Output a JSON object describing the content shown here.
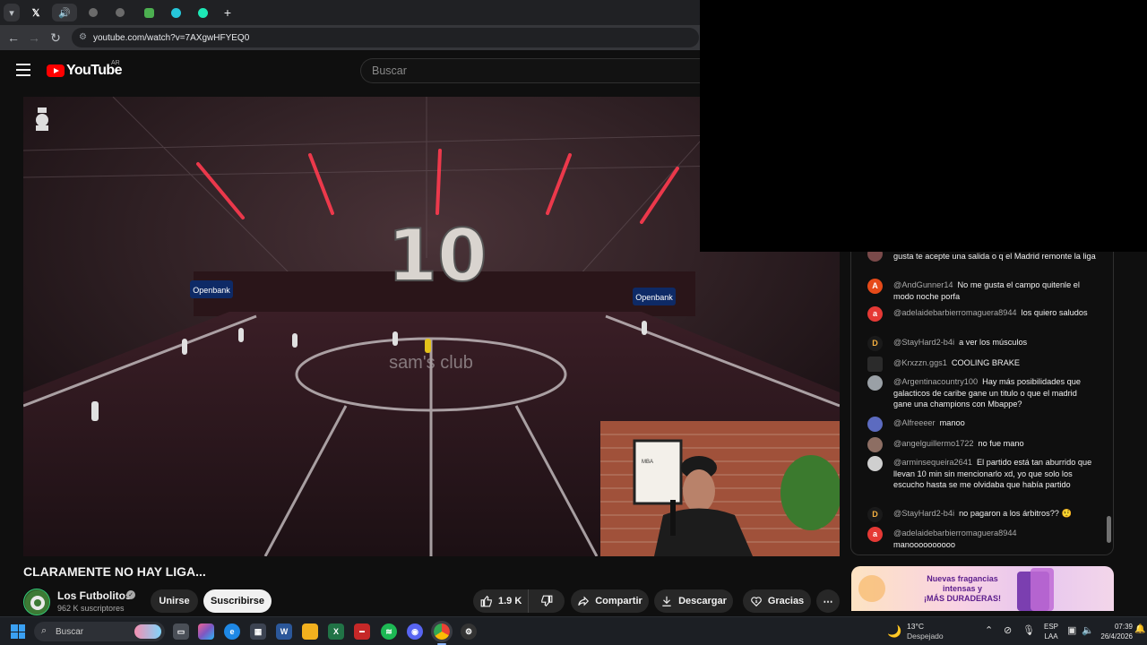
{
  "browser": {
    "url": "youtube.com/watch?v=7AXgwHFYEQ0",
    "tabs": [
      "X",
      "sound",
      "tab",
      "tab",
      "tab",
      "tab",
      "tab"
    ],
    "new_tab": "+"
  },
  "youtube": {
    "logo_text": "YouTube",
    "country": "AR",
    "search_placeholder": "Buscar"
  },
  "video": {
    "title": "CLARAMENTE NO HAY LIGA...",
    "scoreboard_number": "10",
    "sponsor_left": "Openbank",
    "sponsor_right": "Openbank",
    "court_logo": "sam's club",
    "poster_number": "10"
  },
  "channel": {
    "name": "Los Futbolitos",
    "subscribers": "962 K suscriptores",
    "join_label": "Unirse",
    "subscribe_label": "Suscribirse"
  },
  "actions": {
    "likes": "1.9 K",
    "share_label": "Compartir",
    "download_label": "Descargar",
    "thanks_label": "Gracias",
    "more_label": "⋯"
  },
  "chat": {
    "messages": [
      {
        "author": "",
        "text": "gusta te acepte una salida o q el Madrid remonte la liga",
        "avatar": "",
        "avatar_color": "#7a4a4a"
      },
      {
        "author": "@AndGunner14",
        "text": "No me gusta el campo quitenle el modo noche porfa",
        "avatar": "A",
        "avatar_color": "#e64a19"
      },
      {
        "author": "@adelaidebarbierromaguera8944",
        "text": "los quiero saludos",
        "avatar": "a",
        "avatar_color": "#e53935"
      },
      {
        "author": "@StayHard2-b4i",
        "text": "a ver los músculos",
        "avatar": "D",
        "avatar_color": "#1a1a1a"
      },
      {
        "author": "@Krxzzn.ggs1",
        "text": "COOLING BRAKE",
        "avatar": "",
        "avatar_color": "#2b2b2b"
      },
      {
        "author": "@Argentinacountry100",
        "text": "Hay más posibilidades que galacticos de caribe gane un titulo o que el madrid gane una champions con Mbappe?",
        "avatar": "",
        "avatar_color": "#9aa0a6"
      },
      {
        "author": "@Alfreeeer",
        "text": "manoo",
        "avatar": "",
        "avatar_color": "#5c6bc0"
      },
      {
        "author": "@angelguillermo1722",
        "text": "no fue mano",
        "avatar": "",
        "avatar_color": "#8d6e63"
      },
      {
        "author": "@arminsequeira2641",
        "text": "El partido está tan aburrido que llevan 10 min sin mencionarlo xd, yo que solo los escucho hasta se me olvidaba que había partido",
        "avatar": "",
        "avatar_color": "#cfcfcf"
      },
      {
        "author": "@StayHard2-b4i",
        "text": "no pagaron a los árbitros?? 🤨",
        "avatar": "D",
        "avatar_color": "#1a1a1a"
      },
      {
        "author": "@adelaidebarbierromaguera8944",
        "text": "manoooooooooo",
        "avatar": "a",
        "avatar_color": "#e53935"
      }
    ]
  },
  "ad": {
    "line1": "Nuevas fragancias",
    "line2": "intensas y",
    "line3": "¡MÁS DURADERAS!"
  },
  "taskbar": {
    "search_placeholder": "Buscar",
    "weather_temp": "13°C",
    "weather_desc": "Despejado",
    "lang_line1": "ESP",
    "lang_line2": "LAA",
    "time": "07:39",
    "date": "26/4/2026"
  },
  "colors": {
    "yt_red": "#ff0000",
    "bg": "#0f0f0f",
    "pill": "#272727"
  }
}
